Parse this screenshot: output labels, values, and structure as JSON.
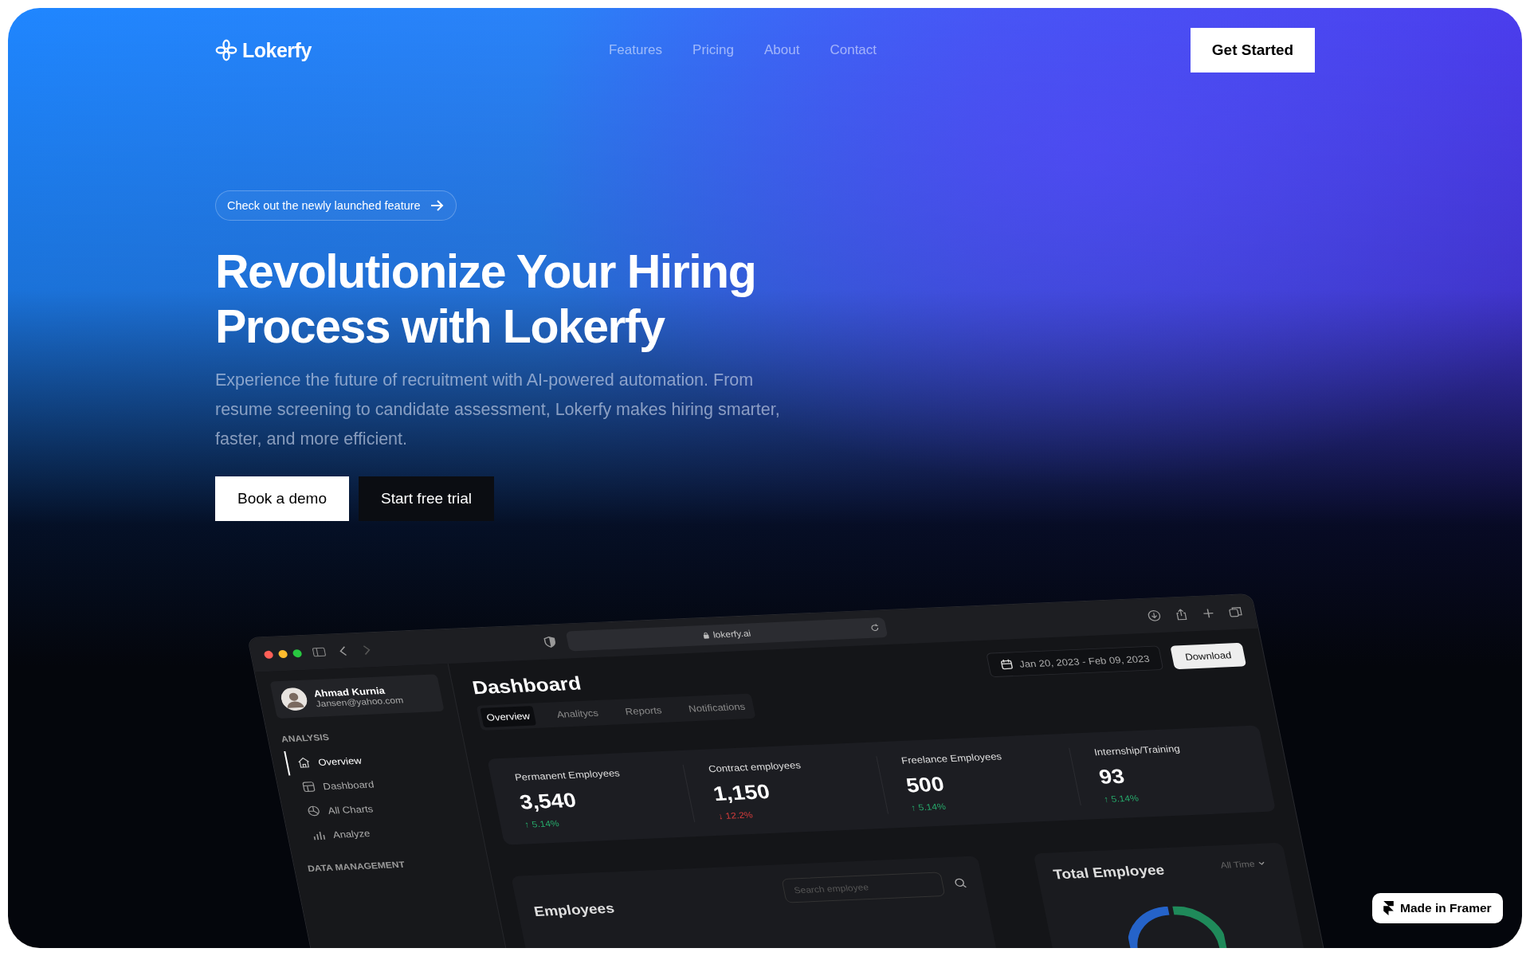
{
  "nav": {
    "logo": "Lokerfy",
    "links": [
      "Features",
      "Pricing",
      "About",
      "Contact"
    ],
    "cta": "Get Started"
  },
  "hero": {
    "badge": "Check out the newly launched feature",
    "title": "Revolutionize Your Hiring Process with Lokerfy",
    "text": "Experience the future of recruitment with AI-powered automation. From resume screening to candidate assessment, Lokerfy makes hiring smarter, faster, and more efficient.",
    "buttons": [
      {
        "label": "Book a demo",
        "kind": "primary"
      },
      {
        "label": "Start free trial",
        "kind": "secondary"
      }
    ]
  },
  "dashboard": {
    "url": "lokerfy.ai",
    "user": {
      "name": "Ahmad Kurnia",
      "email": "Jansen@yahoo.com"
    },
    "sidebar": [
      {
        "heading": "ANALYSIS",
        "items": [
          {
            "label": "Overview",
            "selected": true
          },
          {
            "label": "Dashboard",
            "selected": false
          },
          {
            "label": "All Charts",
            "selected": false
          },
          {
            "label": "Analyze",
            "selected": false
          }
        ]
      },
      {
        "heading": "DATA MANAGEMENT"
      }
    ],
    "title": "Dashboard",
    "date_range": "Jan 20, 2023 - Feb 09, 2023",
    "download": "Download",
    "tabs": [
      {
        "label": "Overview",
        "selected": true
      },
      {
        "label": "Analitycs",
        "selected": false
      },
      {
        "label": "Reports",
        "selected": false
      },
      {
        "label": "Notifications",
        "selected": false
      }
    ],
    "stats": [
      {
        "label": "Permanent Employees",
        "value": "3,540",
        "change": "↑ 5.14%",
        "rising": true
      },
      {
        "label": "Contract employees",
        "value": "1,150",
        "change": "↓ 12.2%",
        "rising": false
      },
      {
        "label": "Freelance Employees",
        "value": "500",
        "change": "↑ 5.14%",
        "rising": true
      },
      {
        "label": "Internship/Training",
        "value": "93",
        "change": "↑ 5.14%",
        "rising": true
      }
    ],
    "employees": {
      "title": "Employees",
      "search_placeholder": "Search employee"
    },
    "total": {
      "title": "Total Employee",
      "period": "All Time"
    }
  },
  "badge": "Made in Framer"
}
